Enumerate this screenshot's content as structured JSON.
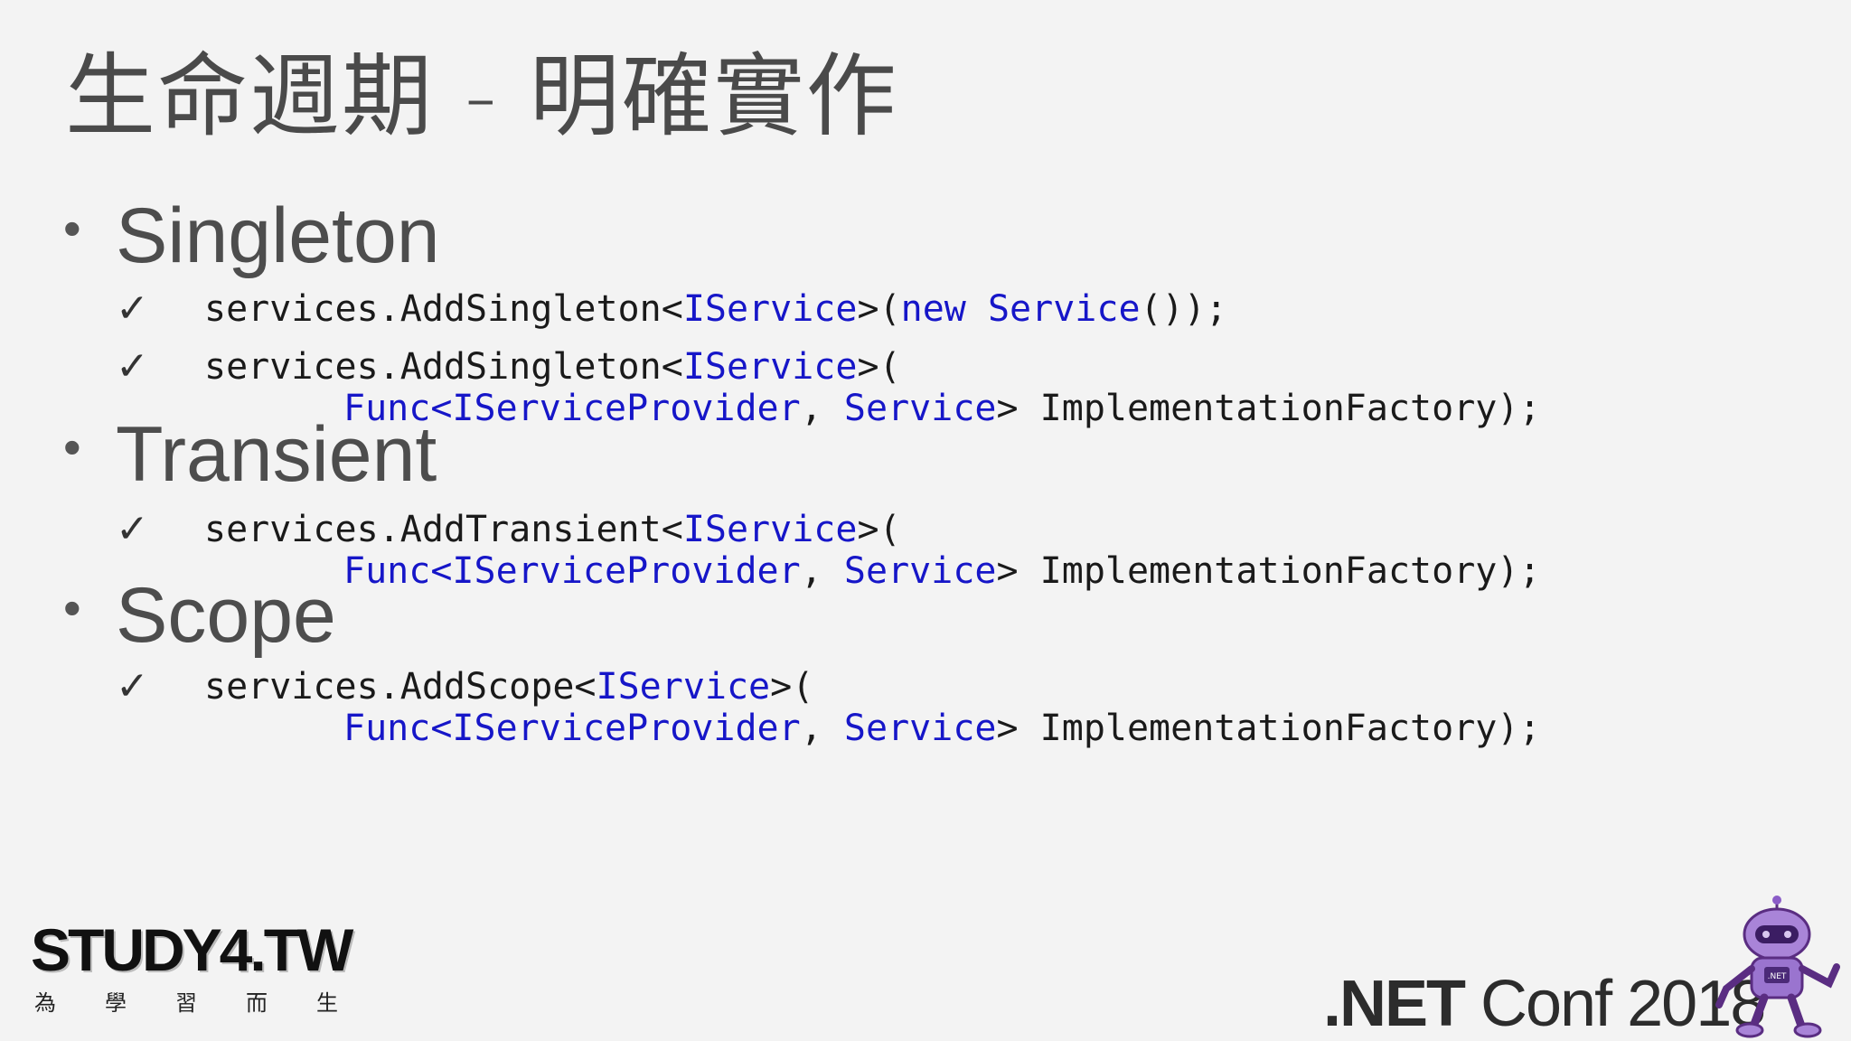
{
  "title": "生命週期 - 明確實作",
  "bullet_symbol": "•",
  "check_symbol": "✓",
  "sections": [
    {
      "name": "Singleton"
    },
    {
      "name": "Transient"
    },
    {
      "name": "Scope"
    }
  ],
  "code": {
    "singleton_1": {
      "a": "services.AddSingleton<",
      "b": "IService",
      "c": ">(",
      "d": "new Service",
      "e": "());"
    },
    "singleton_2": {
      "a": "services.AddSingleton<",
      "b": "IService",
      "c": ">("
    },
    "singleton_2b": {
      "a": "Func<IServiceProvider",
      "b": ", ",
      "c": "Service",
      "d": "> ImplementationFactory);"
    },
    "transient_1": {
      "a": "services.AddTransient<",
      "b": "IService",
      "c": ">("
    },
    "transient_1b": {
      "a": "Func<IServiceProvider",
      "b": ", ",
      "c": "Service",
      "d": "> ImplementationFactory);"
    },
    "scope_1": {
      "a": "services.AddScope<",
      "b": "IService",
      "c": ">("
    },
    "scope_1b": {
      "a": "Func<IServiceProvider",
      "b": ", ",
      "c": "Service",
      "d": "> ImplementationFactory);"
    }
  },
  "branding": {
    "study_logo": "STUDY4.TW",
    "study_tagline": [
      "為",
      "學",
      "習",
      "而",
      "生"
    ],
    "conf_net": ".NET",
    "conf_rest": " Conf 2018",
    "robot_badge": ".NET"
  },
  "colors": {
    "keyword": "#1616c8",
    "background": "#f3f3f3"
  }
}
